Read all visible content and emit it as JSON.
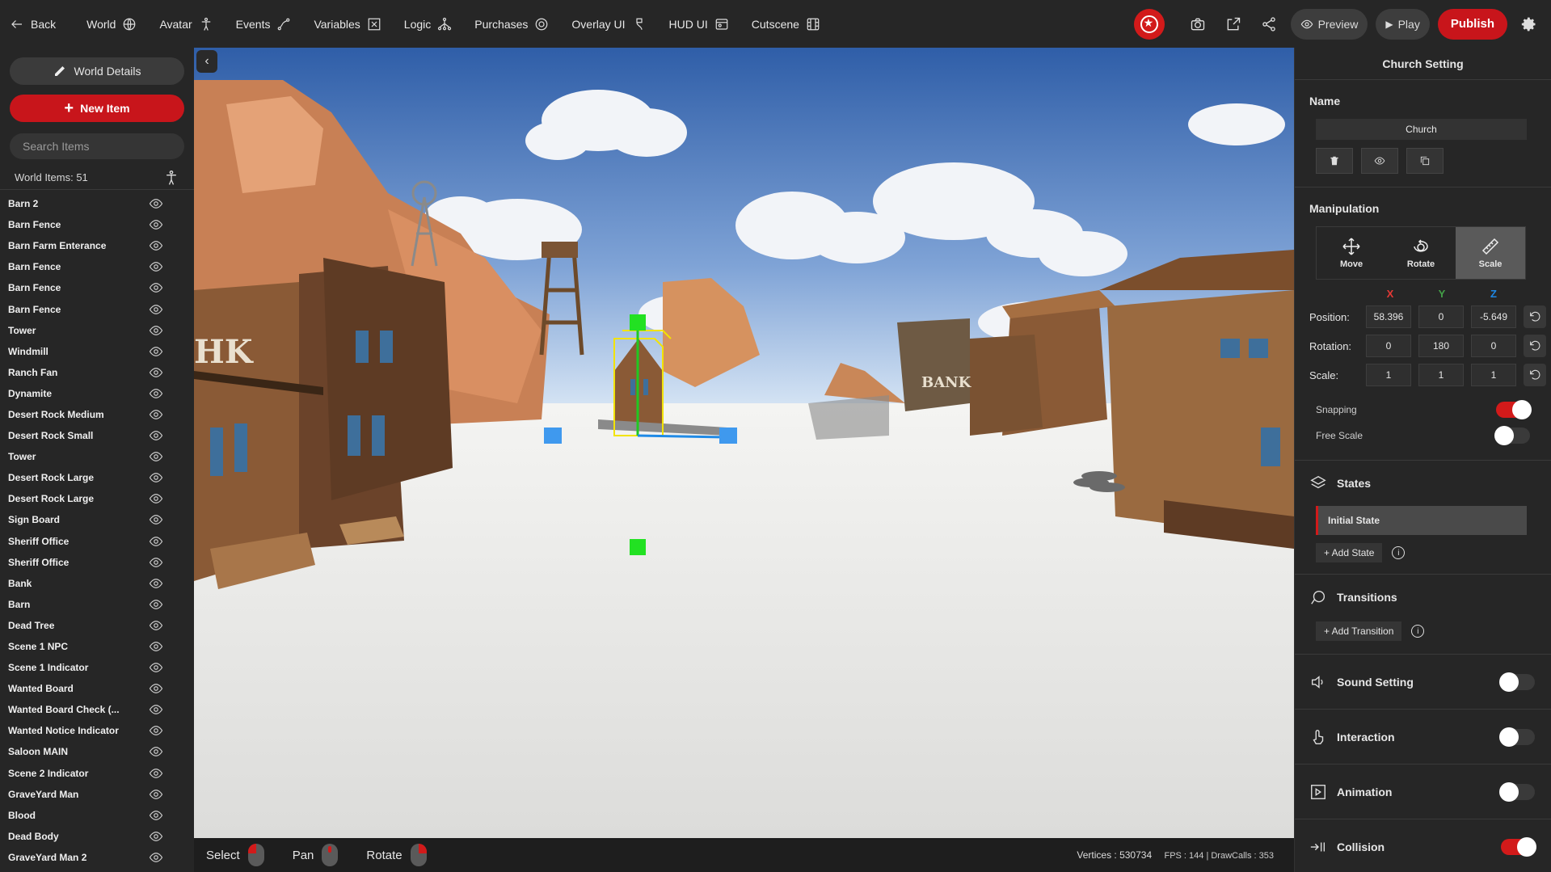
{
  "topbar": {
    "back_label": "Back",
    "nav": [
      {
        "label": "World",
        "icon": "globe-icon"
      },
      {
        "label": "Avatar",
        "icon": "avatar-icon"
      },
      {
        "label": "Events",
        "icon": "events-icon"
      },
      {
        "label": "Variables",
        "icon": "variables-icon"
      },
      {
        "label": "Logic",
        "icon": "logic-icon"
      },
      {
        "label": "Purchases",
        "icon": "purchases-icon"
      },
      {
        "label": "Overlay UI",
        "icon": "overlay-icon"
      },
      {
        "label": "HUD UI",
        "icon": "hud-icon"
      },
      {
        "label": "Cutscene",
        "icon": "cutscene-icon"
      }
    ],
    "preview_label": "Preview",
    "play_label": "Play",
    "publish_label": "Publish"
  },
  "left_panel": {
    "world_details_label": "World Details",
    "new_item_label": "New Item",
    "search_placeholder": "Search Items",
    "world_items_label": "World Items: 51",
    "items": [
      "Barn 2",
      "Barn Fence",
      "Barn Farm Enterance",
      "Barn Fence",
      "Barn Fence",
      "Barn Fence",
      "Tower",
      "Windmill",
      "Ranch Fan",
      "Dynamite",
      "Desert Rock Medium",
      "Desert Rock Small",
      "Tower",
      "Desert Rock Large",
      "Desert Rock Large",
      "Sign Board",
      "Sheriff Office",
      "Sheriff Office",
      "Bank",
      "Barn",
      "Dead Tree",
      "Scene 1 NPC",
      "Scene 1 Indicator",
      "Wanted Board",
      "Wanted Board Check (...",
      "Wanted Notice Indicator",
      "Saloon MAIN",
      "Scene 2 Indicator",
      "GraveYard Man",
      "Blood",
      "Dead Body",
      "GraveYard Man 2"
    ]
  },
  "viewport": {
    "controls": [
      "Select",
      "Pan",
      "Rotate"
    ],
    "vertices_label": "Vertices : 530734",
    "fps_label": "FPS : 144 | DrawCalls : 353"
  },
  "right_panel": {
    "title": "Church Setting",
    "name_label": "Name",
    "name_value": "Church",
    "manipulation_label": "Manipulation",
    "tools": [
      "Move",
      "Rotate",
      "Scale"
    ],
    "active_tool": "Scale",
    "axes": [
      "X",
      "Y",
      "Z"
    ],
    "axis_colors": {
      "x": "#e53935",
      "y": "#43a047",
      "z": "#1e88e5"
    },
    "position_label": "Position:",
    "position": [
      "58.396",
      "0",
      "-5.649"
    ],
    "rotation_label": "Rotation:",
    "rotation": [
      "0",
      "180",
      "0"
    ],
    "scale_label": "Scale:",
    "scale": [
      "1",
      "1",
      "1"
    ],
    "snapping_label": "Snapping",
    "snapping_on": true,
    "free_scale_label": "Free Scale",
    "free_scale_on": false,
    "states_label": "States",
    "initial_state_label": "Initial State",
    "add_state_label": "+ Add State",
    "transitions_label": "Transitions",
    "add_transition_label": "+ Add Transition",
    "features": [
      {
        "label": "Sound Setting",
        "icon": "sound-icon",
        "on": false
      },
      {
        "label": "Interaction",
        "icon": "interaction-icon",
        "on": false
      },
      {
        "label": "Animation",
        "icon": "animation-icon",
        "on": false
      },
      {
        "label": "Collision",
        "icon": "collision-icon",
        "on": true
      }
    ]
  },
  "colors": {
    "accent": "#c8151b",
    "panel": "#262626",
    "sky": "#3f6cb0",
    "ground": "#eeeeee"
  }
}
